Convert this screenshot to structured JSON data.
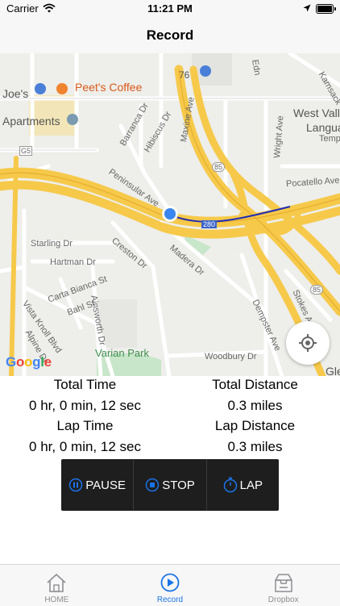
{
  "status_bar": {
    "carrier": "Carrier",
    "time": "11:21 PM"
  },
  "nav": {
    "title": "Record"
  },
  "map": {
    "labels": {
      "joes": "Joe's",
      "peets": "Peet's Coffee",
      "apartments": "Apartments",
      "west_valley": "West Valle",
      "langua": "Langua",
      "temp": "Temp",
      "barranca": "Barranca Dr",
      "hibiscus": "Hibiscus Dr",
      "maxine": "Maxine Ave",
      "peninsular": "Peninsular Ave",
      "wright": "Wright Ave",
      "pocatello": "Pocatello Ave",
      "g5": "G5",
      "r85a": "85",
      "r280": "280",
      "r76": "76",
      "r85b": "85",
      "starling": "Starling Dr",
      "hartman": "Hartman Dr",
      "creston": "Creston Dr",
      "madera": "Madera Dr",
      "carta": "Carta Bianca St",
      "vista": "Vista Knoll Blvd",
      "bahl": "Bahl St",
      "ainsworth": "Ainsworth Dr",
      "alpine": "Alpine Dr",
      "varian": "Varian Park",
      "woodbury": "Woodbury Dr",
      "dempster": "Dempster Ave",
      "stokes": "Stokes Ave",
      "kamsack": "Kamsack",
      "gle": "Gle",
      "edn": "Edn",
      "google": "Google"
    }
  },
  "stats": {
    "total_time_label": "Total Time",
    "total_time_value": "0 hr, 0 min, 12 sec",
    "total_distance_label": "Total Distance",
    "total_distance_value": "0.3 miles",
    "lap_time_label": "Lap Time",
    "lap_time_value": "0 hr, 0 min, 12 sec",
    "lap_distance_label": "Lap Distance",
    "lap_distance_value": "0.3 miles"
  },
  "controls": {
    "pause": "PAUSE",
    "stop": "STOP",
    "lap": "LAP"
  },
  "tabs": [
    {
      "label": "HOME",
      "icon": "home-icon",
      "active": false
    },
    {
      "label": "Record",
      "icon": "play-icon",
      "active": true
    },
    {
      "label": "Dropbox",
      "icon": "dropbox-icon",
      "active": false
    }
  ],
  "colors": {
    "accent": "#1a73e8",
    "control_bg": "#1e1e1e",
    "route": "#1f2bb5"
  }
}
